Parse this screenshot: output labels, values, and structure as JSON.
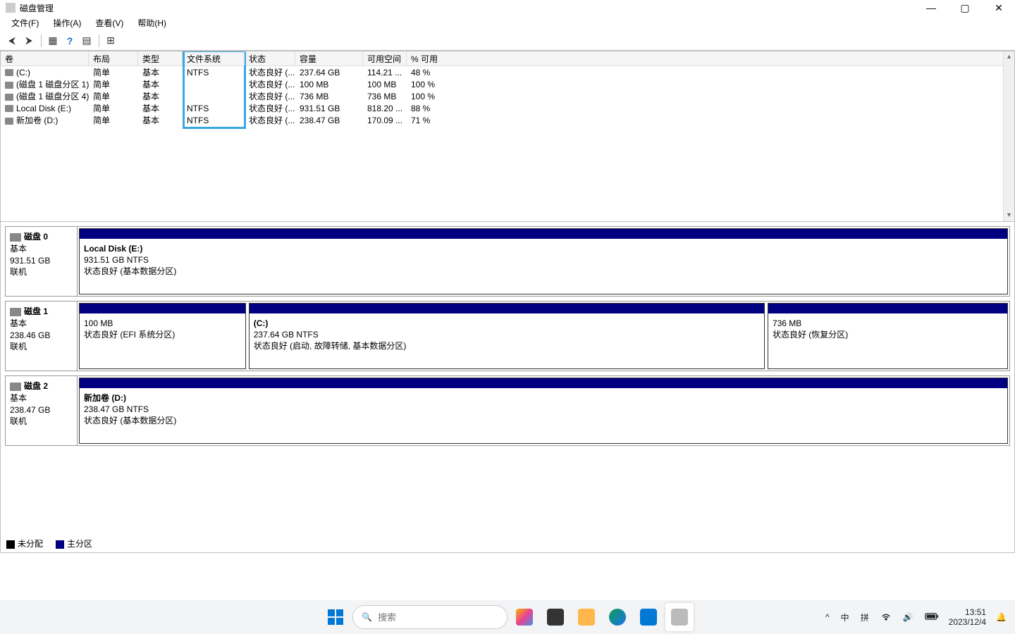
{
  "window": {
    "title": "磁盘管理"
  },
  "menu": {
    "file": "文件(F)",
    "action": "操作(A)",
    "view": "查看(V)",
    "help": "帮助(H)"
  },
  "columns": {
    "volume": "卷",
    "layout": "布局",
    "type": "类型",
    "fs": "文件系统",
    "status": "状态",
    "capacity": "容量",
    "free": "可用空间",
    "pct": "% 可用"
  },
  "volumes": [
    {
      "name": "(C:)",
      "layout": "简单",
      "type": "基本",
      "fs": "NTFS",
      "status": "状态良好 (...",
      "capacity": "237.64 GB",
      "free": "114.21 ...",
      "pct": "48 %"
    },
    {
      "name": "(磁盘 1 磁盘分区 1)",
      "layout": "简单",
      "type": "基本",
      "fs": "",
      "status": "状态良好 (...",
      "capacity": "100 MB",
      "free": "100 MB",
      "pct": "100 %"
    },
    {
      "name": "(磁盘 1 磁盘分区 4)",
      "layout": "简单",
      "type": "基本",
      "fs": "",
      "status": "状态良好 (...",
      "capacity": "736 MB",
      "free": "736 MB",
      "pct": "100 %"
    },
    {
      "name": "Local Disk (E:)",
      "layout": "简单",
      "type": "基本",
      "fs": "NTFS",
      "status": "状态良好 (...",
      "capacity": "931.51 GB",
      "free": "818.20 ...",
      "pct": "88 %"
    },
    {
      "name": "新加卷 (D:)",
      "layout": "简单",
      "type": "基本",
      "fs": "NTFS",
      "status": "状态良好 (...",
      "capacity": "238.47 GB",
      "free": "170.09 ...",
      "pct": "71 %"
    }
  ],
  "disks": [
    {
      "label": "磁盘 0",
      "type": "基本",
      "size": "931.51 GB",
      "status": "联机",
      "parts": [
        {
          "name": "Local Disk  (E:)",
          "detail": "931.51 GB NTFS",
          "status": "状态良好 (基本数据分区)",
          "flex": 1
        }
      ]
    },
    {
      "label": "磁盘 1",
      "type": "基本",
      "size": "238.46 GB",
      "status": "联机",
      "parts": [
        {
          "name": "",
          "detail": "100 MB",
          "status": "状态良好 (EFI 系统分区)",
          "flex": 0.18
        },
        {
          "name": "(C:)",
          "detail": "237.64 GB NTFS",
          "status": "状态良好 (启动, 故障转储, 基本数据分区)",
          "flex": 0.56
        },
        {
          "name": "",
          "detail": "736 MB",
          "status": "状态良好 (恢复分区)",
          "flex": 0.26
        }
      ]
    },
    {
      "label": "磁盘 2",
      "type": "基本",
      "size": "238.47 GB",
      "status": "联机",
      "parts": [
        {
          "name": "新加卷  (D:)",
          "detail": "238.47 GB NTFS",
          "status": "状态良好 (基本数据分区)",
          "flex": 1
        }
      ]
    }
  ],
  "legend": {
    "unalloc": "未分配",
    "primary": "主分区"
  },
  "search": {
    "placeholder": "搜索"
  },
  "tray": {
    "ime1": "中",
    "ime2": "拼",
    "time": "13:51",
    "date": "2023/12/4"
  }
}
